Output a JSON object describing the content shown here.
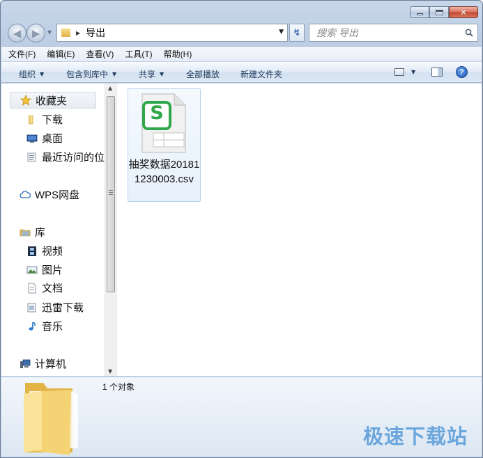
{
  "window": {
    "caption": {
      "minimize": "–",
      "close": "✕"
    }
  },
  "nav": {
    "back_glyph": "◀",
    "forward_glyph": "▶",
    "history_drop": "▼",
    "address": {
      "separator": "▶",
      "current_folder": "导出",
      "drop": "▼"
    },
    "refresh_glyph": "↯",
    "search": {
      "placeholder": "搜索 导出"
    }
  },
  "menubar": {
    "items": [
      "文件(F)",
      "编辑(E)",
      "查看(V)",
      "工具(T)",
      "帮助(H)"
    ]
  },
  "toolbar": {
    "organize": "组织",
    "include_in_library": "包含到库中",
    "share": "共享",
    "play_all": "全部播放",
    "new_folder": "新建文件夹",
    "dropdown_arrow": "▼",
    "help_glyph": "?"
  },
  "navpane": {
    "favorites": "收藏夹",
    "downloads": "下载",
    "desktop": "桌面",
    "recent": "最近访问的位",
    "wps": "WPS网盘",
    "libraries": "库",
    "videos": "视频",
    "pictures": "图片",
    "documents": "文档",
    "xunlei": "迅雷下载",
    "music": "音乐",
    "computer": "计算机"
  },
  "scrollbar": {
    "up": "▲",
    "down": "▼"
  },
  "files": [
    {
      "name": "抽奖数据201811230003.csv",
      "icon": "wps-spreadsheet-csv-icon",
      "badge": "S"
    }
  ],
  "details": {
    "count": "1 个对象"
  },
  "watermark": "极速下载站",
  "colors": {
    "wps_green": "#2ea84a",
    "accent_blue": "#1e395b",
    "selection": "#e7f1fb"
  }
}
